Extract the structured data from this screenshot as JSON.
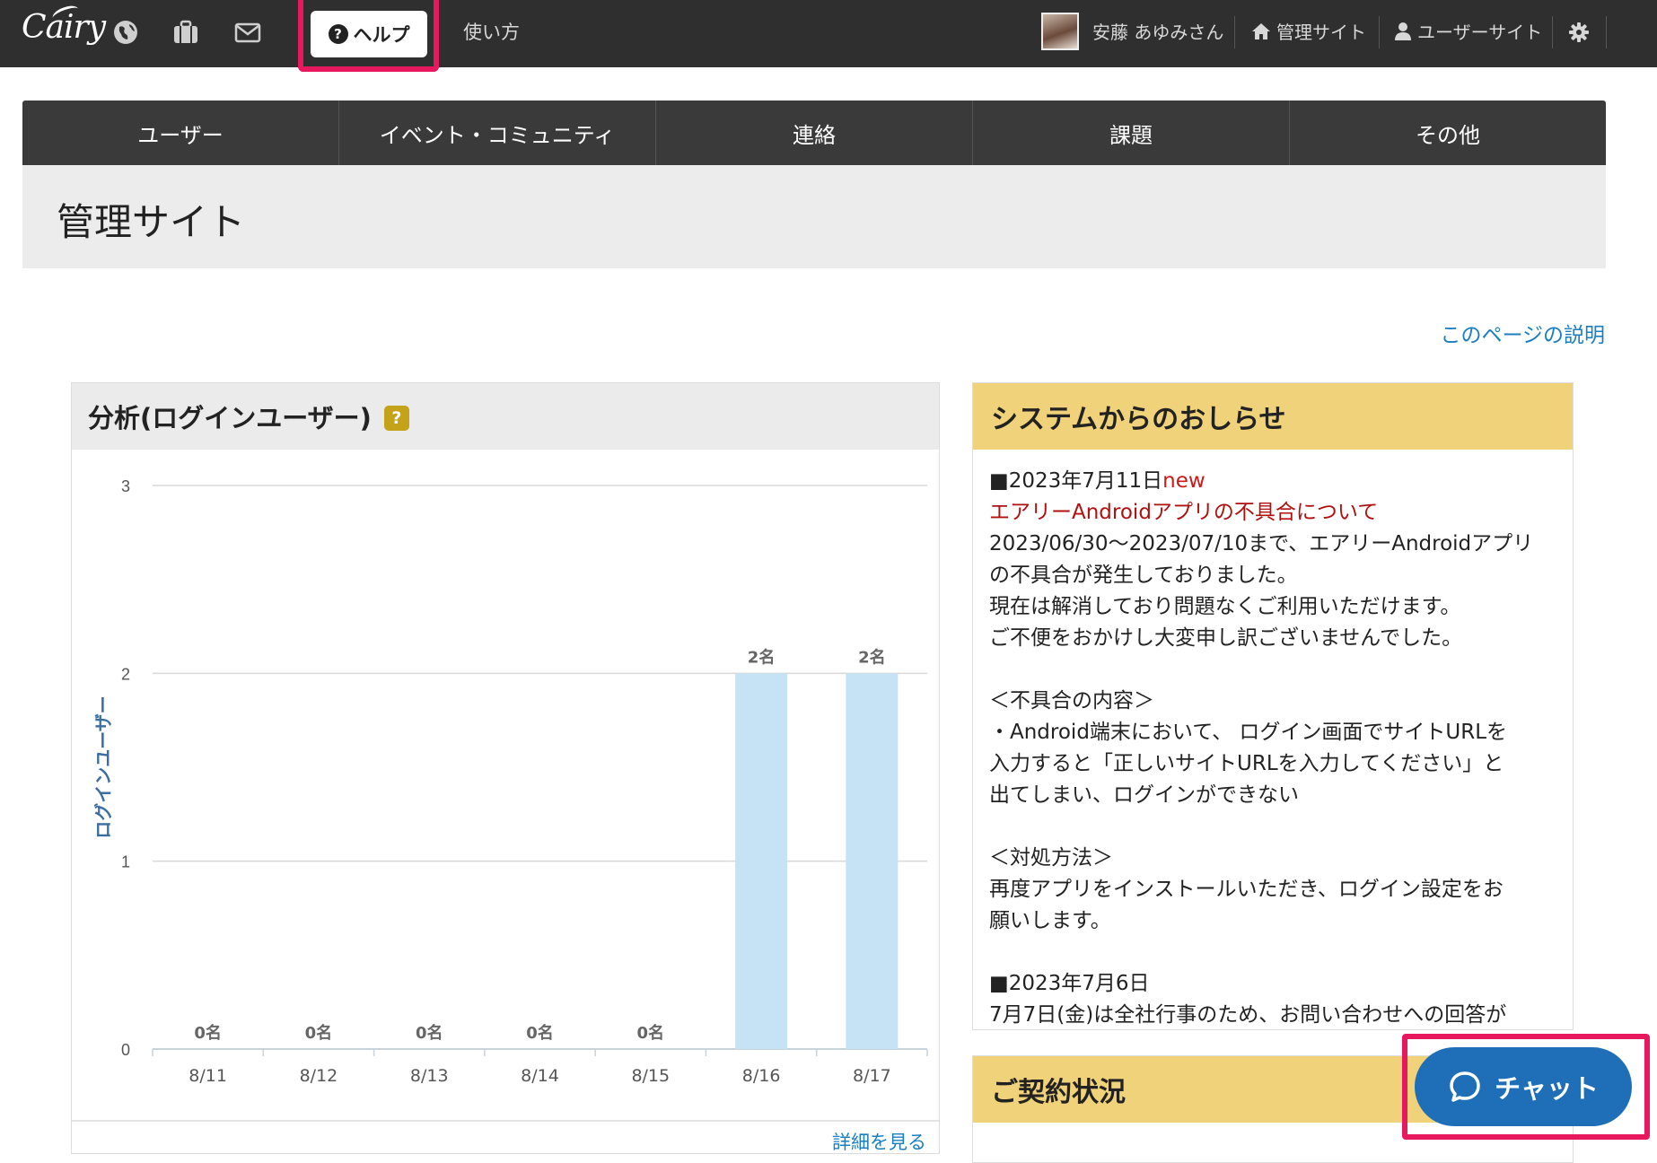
{
  "topbar": {
    "logo": "Cairy",
    "help_label": "ヘルプ",
    "usage_label": "使い方",
    "user_name": "安藤 あゆみさん",
    "admin_site_label": "管理サイト",
    "user_site_label": "ユーザーサイト",
    "icons": [
      "globe-icon",
      "briefcase-icon",
      "envelope-icon",
      "help-circle-icon",
      "home-icon",
      "user-icon",
      "gear-icon"
    ]
  },
  "nav": {
    "items": [
      {
        "label": "ユーザー"
      },
      {
        "label": "イベント・コミュニティ"
      },
      {
        "label": "連絡"
      },
      {
        "label": "課題"
      },
      {
        "label": "その他"
      }
    ]
  },
  "page": {
    "title": "管理サイト",
    "explain_link": "このページの説明"
  },
  "analysis": {
    "title": "分析(ログインユーザー)",
    "badge": "?",
    "detail_link": "詳細を見る"
  },
  "chart_data": {
    "type": "bar",
    "categories": [
      "8/11",
      "8/12",
      "8/13",
      "8/14",
      "8/15",
      "8/16",
      "8/17"
    ],
    "values": [
      0,
      0,
      0,
      0,
      0,
      2,
      2
    ],
    "data_labels": [
      "0名",
      "0名",
      "0名",
      "0名",
      "0名",
      "2名",
      "2名"
    ],
    "ylabel": "ログインユーザー",
    "ylim": [
      0,
      3
    ],
    "yticks": [
      "0",
      "1",
      "2",
      "3"
    ],
    "grid": true,
    "bar_color": "#c5e3f4"
  },
  "notice": {
    "title": "システムからのおしらせ",
    "entry1_date": "■2023年7月11日",
    "entry1_new": "new",
    "entry1_link": "エアリーAndroidアプリの不具合について",
    "entry1_line1": "2023/06/30〜2023/07/10まで、エアリーAndroidアプリ",
    "entry1_line2": "の不具合が発生しておりました。",
    "entry1_line3": "現在は解消しており問題なくご利用いただけます。",
    "entry1_line4": "ご不便をおかけし大変申し訳ございませんでした。",
    "content_head": "＜不具合の内容＞",
    "content_line1": "・Android端末において、 ログイン画面でサイトURLを",
    "content_line2": "入力すると「正しいサイトURLを入力してください」と",
    "content_line3": "出てしまい、ログインができない",
    "fix_head": "＜対処方法＞",
    "fix_line1": "再度アプリをインストールいただき、ログイン設定をお",
    "fix_line2": "願いします。",
    "entry2_date": "■2023年7月6日",
    "entry2_partial": "7月7日(金)は全社行事のため、お問い合わせへの回答が"
  },
  "contract": {
    "title": "ご契約状況"
  },
  "chat": {
    "label": "チャット"
  },
  "colors": {
    "topbar": "#2f2f2f",
    "highlight": "#e8185f",
    "notice_header": "#efd27a",
    "link": "#1a7fc0",
    "chat": "#1f6fb8"
  }
}
